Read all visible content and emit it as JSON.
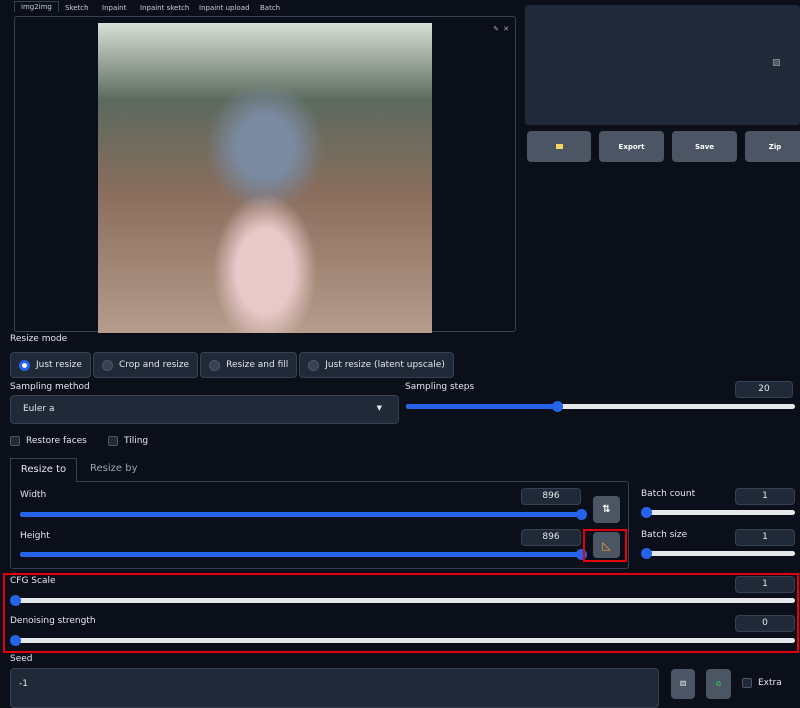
{
  "tabs": [
    "img2img",
    "Sketch",
    "Inpaint",
    "Inpaint sketch",
    "Inpaint upload",
    "Batch"
  ],
  "gallery": {
    "buttons": {
      "folder": "folder-icon",
      "export": "Export",
      "save": "Save",
      "zip": "Zip"
    }
  },
  "resize_mode": {
    "label": "Resize mode",
    "options": [
      "Just resize",
      "Crop and resize",
      "Resize and fill",
      "Just resize (latent upscale)"
    ],
    "selected": "Just resize"
  },
  "sampling": {
    "method_label": "Sampling method",
    "method": "Euler a",
    "steps_label": "Sampling steps",
    "steps": 20
  },
  "checks": {
    "restore_faces": "Restore faces",
    "tiling": "Tiling"
  },
  "resize_tabs": {
    "to": "Resize to",
    "by": "Resize by"
  },
  "width": {
    "label": "Width",
    "value": 896
  },
  "height": {
    "label": "Height",
    "value": 896
  },
  "batch_count": {
    "label": "Batch count",
    "value": 1
  },
  "batch_size": {
    "label": "Batch size",
    "value": 1
  },
  "cfg": {
    "label": "CFG Scale",
    "value": 1
  },
  "denoise": {
    "label": "Denoising strength",
    "value": 0
  },
  "seed": {
    "label": "Seed",
    "value": "-1",
    "extra": "Extra"
  },
  "colors": {
    "accent": "#2563eb",
    "highlight": "#e3000f",
    "background": "#0b0f19"
  }
}
